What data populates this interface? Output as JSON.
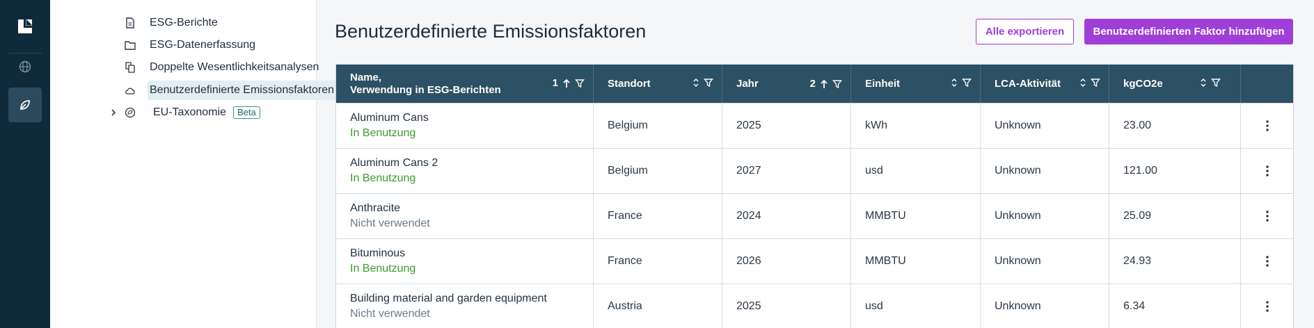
{
  "sidebar": {
    "items": [
      {
        "label": "ESG-Berichte",
        "icon": "document-icon"
      },
      {
        "label": "ESG-Datenerfassung",
        "icon": "folder-icon"
      },
      {
        "label": "Doppelte Wesentlichkeitsanalysen",
        "icon": "copy-documents-icon"
      },
      {
        "label": "Benutzerdefinierte Emissionsfaktoren",
        "icon": "cloud-icon"
      },
      {
        "label": "EU-Taxonomie",
        "icon": "eu-leaf-icon",
        "badge": "Beta"
      }
    ]
  },
  "page": {
    "title": "Benutzerdefinierte Emissionsfaktoren",
    "export_label": "Alle exportieren",
    "add_label": "Benutzerdefinierten Faktor hinzufügen"
  },
  "table": {
    "columns": [
      {
        "label_line1": "Name,",
        "label_line2": "Verwendung in ESG-Berichten",
        "sort_index": "1"
      },
      {
        "label": "Standort"
      },
      {
        "label": "Jahr",
        "sort_index": "2"
      },
      {
        "label": "Einheit"
      },
      {
        "label": "LCA-Aktivität"
      },
      {
        "label": "kgCO2e"
      }
    ],
    "rows": [
      {
        "name": "Aluminum Cans",
        "status": "In Benutzung",
        "used": true,
        "location": "Belgium",
        "year": "2025",
        "unit": "kWh",
        "lca": "Unknown",
        "kgco2e": "23.00"
      },
      {
        "name": "Aluminum Cans 2",
        "status": "In Benutzung",
        "used": true,
        "location": "Belgium",
        "year": "2027",
        "unit": "usd",
        "lca": "Unknown",
        "kgco2e": "121.00"
      },
      {
        "name": "Anthracite",
        "status": "Nicht verwendet",
        "used": false,
        "location": "France",
        "year": "2024",
        "unit": "MMBTU",
        "lca": "Unknown",
        "kgco2e": "25.09"
      },
      {
        "name": "Bituminous",
        "status": "In Benutzung",
        "used": true,
        "location": "France",
        "year": "2026",
        "unit": "MMBTU",
        "lca": "Unknown",
        "kgco2e": "24.93"
      },
      {
        "name": "Building material and garden equipment",
        "status": "Nicht verwendet",
        "used": false,
        "location": "Austria",
        "year": "2025",
        "unit": "usd",
        "lca": "Unknown",
        "kgco2e": "6.34"
      }
    ]
  },
  "colors": {
    "rail": "#0f2a3b",
    "header": "#2c5064",
    "accent": "#a03fd8",
    "in_use": "#3d9a2f"
  }
}
